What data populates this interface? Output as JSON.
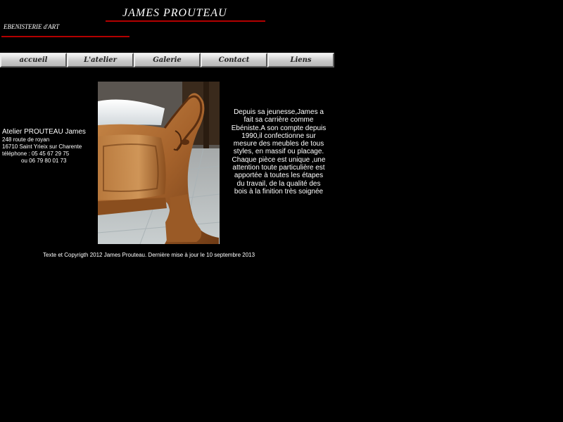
{
  "header": {
    "title": "JAMES  PROUTEAU",
    "subtitle": "EBENISTERIE d'ART",
    "accent_color": "#b30000"
  },
  "nav": {
    "items": [
      {
        "label": "accueil"
      },
      {
        "label": "L'atelier"
      },
      {
        "label": "Galerie"
      },
      {
        "label": "Contact"
      },
      {
        "label": "Liens"
      }
    ]
  },
  "contact": {
    "name": "Atelier PROUTEAU James",
    "address1": "248 route de royan",
    "address2": "16710 Saint Yrieix sur Charente",
    "phone": "téléphone : 05 45 67 29 75",
    "mobile": "ou   06 79 80 01 73"
  },
  "intro": {
    "text": "Depuis sa jeunesse,James a fait sa carrière comme Ebéniste.A son compte depuis 1990,il confectionne sur mesure des meubles de tous styles, en massif ou placage. Chaque pièce est unique ,une attention toute particulière est apportée à toutes les étapes du travail, de la qualité des bois à la finition très soignée"
  },
  "photo": {
    "icon": "carved-wood-furniture-photo"
  },
  "footer": {
    "text": "Texte et Copyrigth 2012 James Prouteau. Dernière mise à jour le  10  septembre  2013"
  }
}
